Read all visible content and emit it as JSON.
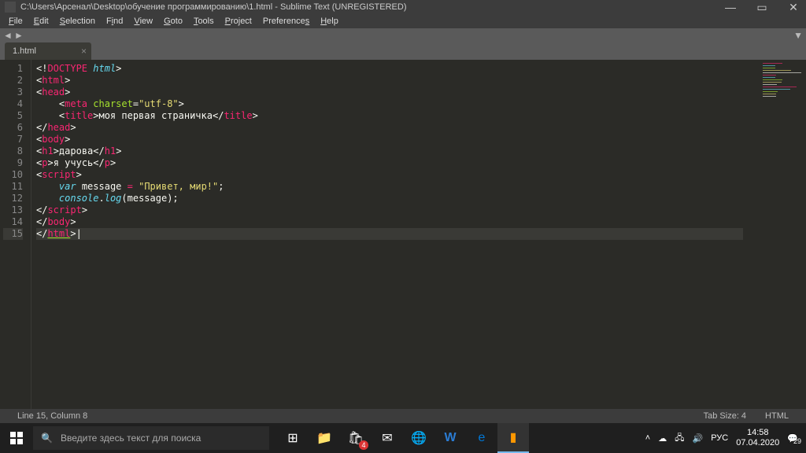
{
  "window": {
    "title": "C:\\Users\\Арсенал\\Desktop\\обучение программированию\\1.html - Sublime Text (UNREGISTERED)"
  },
  "menu": {
    "items": [
      "File",
      "Edit",
      "Selection",
      "Find",
      "View",
      "Goto",
      "Tools",
      "Project",
      "Preferences",
      "Help"
    ]
  },
  "tabs": {
    "active": "1.html"
  },
  "code": {
    "lines": [
      {
        "n": 1,
        "segs": [
          [
            "<!",
            "t-white"
          ],
          [
            "DOCTYPE",
            "t-pink"
          ],
          [
            " ",
            "t-white"
          ],
          [
            "html",
            "t-bluei"
          ],
          [
            ">",
            "t-white"
          ]
        ]
      },
      {
        "n": 2,
        "segs": [
          [
            "<",
            "t-white"
          ],
          [
            "html",
            "t-pink"
          ],
          [
            ">",
            "t-white"
          ]
        ]
      },
      {
        "n": 3,
        "segs": [
          [
            "<",
            "t-white"
          ],
          [
            "head",
            "t-pink"
          ],
          [
            ">",
            "t-white"
          ]
        ]
      },
      {
        "n": 4,
        "segs": [
          [
            "    <",
            "t-white"
          ],
          [
            "meta",
            "t-pink"
          ],
          [
            " ",
            "t-white"
          ],
          [
            "charset",
            "t-green"
          ],
          [
            "=",
            "t-white"
          ],
          [
            "\"utf-8\"",
            "t-yellow"
          ],
          [
            ">",
            "t-white"
          ]
        ]
      },
      {
        "n": 5,
        "segs": [
          [
            "    <",
            "t-white"
          ],
          [
            "title",
            "t-pink"
          ],
          [
            ">",
            "t-white"
          ],
          [
            "моя первая страничка",
            "t-white"
          ],
          [
            "</",
            "t-white"
          ],
          [
            "title",
            "t-pink"
          ],
          [
            ">",
            "t-white"
          ]
        ]
      },
      {
        "n": 6,
        "segs": [
          [
            "</",
            "t-white"
          ],
          [
            "head",
            "t-pink"
          ],
          [
            ">",
            "t-white"
          ]
        ]
      },
      {
        "n": 7,
        "segs": [
          [
            "<",
            "t-white"
          ],
          [
            "body",
            "t-pink"
          ],
          [
            ">",
            "t-white"
          ]
        ]
      },
      {
        "n": 8,
        "segs": [
          [
            "<",
            "t-white"
          ],
          [
            "h1",
            "t-pink"
          ],
          [
            ">",
            "t-white"
          ],
          [
            "дарова",
            "t-white"
          ],
          [
            "</",
            "t-white"
          ],
          [
            "h1",
            "t-pink"
          ],
          [
            ">",
            "t-white"
          ]
        ]
      },
      {
        "n": 9,
        "segs": [
          [
            "<",
            "t-white"
          ],
          [
            "p",
            "t-pink"
          ],
          [
            ">",
            "t-white"
          ],
          [
            "я учусь",
            "t-white"
          ],
          [
            "</",
            "t-white"
          ],
          [
            "p",
            "t-pink"
          ],
          [
            ">",
            "t-white"
          ]
        ]
      },
      {
        "n": 10,
        "segs": [
          [
            "<",
            "t-white"
          ],
          [
            "script",
            "t-pink"
          ],
          [
            ">",
            "t-white"
          ]
        ]
      },
      {
        "n": 11,
        "segs": [
          [
            "    ",
            "t-white"
          ],
          [
            "var",
            "t-bluei"
          ],
          [
            " message ",
            "t-white"
          ],
          [
            "=",
            "t-pink"
          ],
          [
            " ",
            "t-white"
          ],
          [
            "\"Привет, мир!\"",
            "t-yellow"
          ],
          [
            ";",
            "t-white"
          ]
        ]
      },
      {
        "n": 12,
        "segs": [
          [
            "    ",
            "t-white"
          ],
          [
            "console",
            "t-bluei"
          ],
          [
            ".",
            "t-white"
          ],
          [
            "log",
            "t-bluei"
          ],
          [
            "(message);",
            "t-white"
          ]
        ]
      },
      {
        "n": 13,
        "segs": [
          [
            "</",
            "t-white"
          ],
          [
            "script",
            "t-pink"
          ],
          [
            ">",
            "t-white"
          ]
        ]
      },
      {
        "n": 14,
        "segs": [
          [
            "</",
            "t-white"
          ],
          [
            "body",
            "t-pink"
          ],
          [
            ">",
            "t-white"
          ]
        ]
      },
      {
        "n": 15,
        "segs": [
          [
            "</",
            "t-white"
          ],
          [
            "html",
            "t-pink underline"
          ],
          [
            ">",
            "t-white"
          ]
        ],
        "cursor": true,
        "current": true
      }
    ]
  },
  "status": {
    "pos": "Line 15, Column 8",
    "tabsize": "Tab Size: 4",
    "lang": "HTML"
  },
  "taskbar": {
    "search_placeholder": "Введите здесь текст для поиска",
    "tray": {
      "lang": "РУС",
      "time": "14:58",
      "date": "07.04.2020",
      "badge": "29"
    }
  }
}
